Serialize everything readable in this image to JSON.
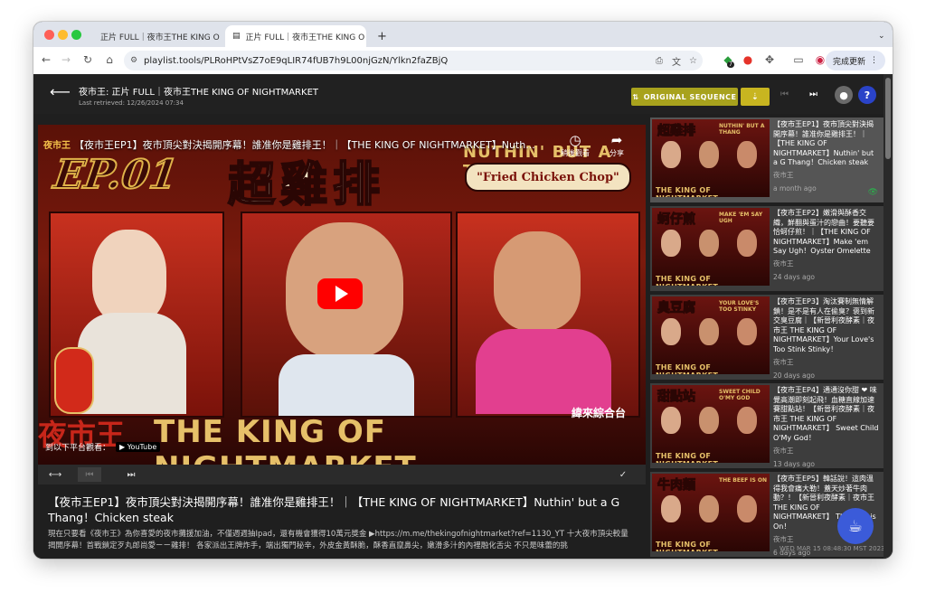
{
  "browser": {
    "tabs": [
      {
        "title": "正片 FULL｜夜市王THE KING O",
        "active": false
      },
      {
        "title": "正片 FULL｜夜市王THE KING O",
        "active": true
      }
    ],
    "new_tab": "+",
    "url": "playlist.tools/PLRoHPtVsZ7oE9qLIR74fUB7h9L00njGzN/Ylkn2faZBjQ",
    "ext_badge": "7",
    "update_label": "完成更新"
  },
  "header": {
    "title": "夜市王: 正片 FULL｜夜市王THE KING OF NIGHTMARKET",
    "retrieved": "Last retrieved: 12/26/2024 07:34",
    "sequence_label": "ORIGINAL SEQUENCE",
    "help": "?"
  },
  "player": {
    "channel_logo": "夜市王",
    "video_title": "【夜市王EP1】夜市頂尖對決揭開序幕！誰准你是雞排王！｜【THE KING OF NIGHTMARKET】Nuth...",
    "watch_later": "稍後觀看",
    "share": "分享",
    "watch_on": "到以下平台觀看：",
    "youtube": "YouTube",
    "thumb_ep": "EP.01",
    "thumb_big": "超雞排",
    "thumb_nuthin": "NUTHIN' BUT A THANG",
    "thumb_chop": "\"Fried Chicken Chop\"",
    "thumb_kom": "THE KING OF NIGHTMARKET",
    "thumb_kom_left": "夜市王",
    "station": "緯來綜合台"
  },
  "description": {
    "title": "【夜市王EP1】夜市頂尖對決揭開序幕！誰准你是雞排王！｜【THE KING OF NIGHTMARKET】Nuthin' but a G Thang！Chicken steak",
    "body": "現在只要看《夜市王》為你喜愛的夜市攤援加油，不僅週週抽Ipad，還有機會獲得10萬元獎金 ▶https://m.me/thekingofnightmarket?ref=1130_YT 十大夜市頂尖較量揭開序幕！首戰鎖定歹丸郎尚愛ㄧㄧ雞排！ 各家派出王牌炸手，端出獨門秘辛，外皮金黃酥脆，酥香直竄鼻尖，嫩滑多汁的內裡融化舌尖 不只是味蕾的挑"
  },
  "playlist": [
    {
      "title": "【夜市王EP1】夜市頂尖對決揭開序幕！誰准你是雞排王！｜【THE KING OF NIGHTMARKET】Nuthin' but a G Thang！Chicken steak",
      "channel": "夜市王",
      "date": "a month ago",
      "thumb_text": "超雞排",
      "thumb_sub": "NUTHIN' BUT A THANG",
      "watched": "👁"
    },
    {
      "title": "【夜市王EP2】嫩滑與酥香交織，鮮翻與蛋汁的戀曲！要聽要恰蚵仔煎！｜【THE KING OF NIGHTMARKET】Make 'em Say Ugh！Oyster Omelette",
      "channel": "夜市王",
      "date": "24 days ago",
      "thumb_text": "蚵仔煎",
      "thumb_sub": "MAKE 'EM SAY UGH"
    },
    {
      "title": "【夜市王EP3】淘汰賽制無情解鎖！是不是有人在偷臭？褒到新交臭豆腐｜【新晉利夜酵素｜夜市王 THE KING OF NIGHTMARKET】Your Love's Too Stink Stinky！",
      "channel": "夜市王",
      "date": "20 days ago",
      "thumb_text": "臭豆腐",
      "thumb_sub": "YOUR LOVE'S TOO STINKY"
    },
    {
      "title": "【夜市王EP4】通通沒你甜 ❤ 味覺高潮即刻起飛！血糖直線加速賽甜點站！【新晉利夜酵素｜夜市王 THE KING OF NIGHTMARKET】 Sweet Child O'My God！",
      "channel": "夜市王",
      "date": "13 days ago",
      "thumb_text": "甜點站",
      "thumb_sub": "SWEET CHILD O'MY GOD"
    },
    {
      "title": "【夜市王EP5】韓話說！這肉溫得我會痛大勒！蓋天炒著牛肉動？！【新晉利夜酵素｜夜市王 THE KING OF NIGHTMARKET】 The Beef is On！",
      "channel": "夜市王",
      "date": "6 days ago",
      "thumb_text": "牛肉麵",
      "thumb_sub": "THE BEEF IS ON"
    }
  ],
  "clock": "WED MAR 15 08:48:30 MST 2023",
  "colors": {
    "accent": "#a8a21d",
    "help": "#2a43c8",
    "youtube_red": "#ff0000"
  }
}
